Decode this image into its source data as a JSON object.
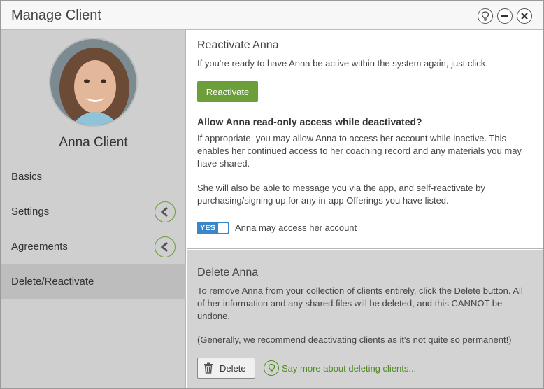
{
  "window": {
    "title": "Manage Client"
  },
  "sidebar": {
    "client_name": "Anna Client",
    "items": [
      {
        "label": "Basics",
        "has_arrow": false,
        "active": false
      },
      {
        "label": "Settings",
        "has_arrow": true,
        "active": false
      },
      {
        "label": "Agreements",
        "has_arrow": true,
        "active": false
      },
      {
        "label": "Delete/Reactivate",
        "has_arrow": false,
        "active": true
      }
    ]
  },
  "reactivate": {
    "title": "Reactivate Anna",
    "text": "If you're ready to have Anna be active within the system again, just click.",
    "button_label": "Reactivate",
    "question": "Allow Anna read-only access while deactivated?",
    "paragraph1": "If appropriate, you may allow Anna to access her account while inactive. This enables her continued access to her coaching record and any materials you may have shared.",
    "paragraph2": "She will also be able to message you via the app, and self-reactivate by purchasing/signing up for any in-app Offerings you have listed.",
    "toggle_state": "YES",
    "toggle_label": "Anna may access her account"
  },
  "delete": {
    "title": "Delete Anna",
    "paragraph1": "To remove Anna from your collection of clients entirely, click the Delete button. All of her information and any shared files will be deleted, and this CANNOT be undone.",
    "paragraph2": "(Generally, we recommend deactivating clients as it's not quite so permanent!)",
    "button_label": "Delete",
    "more_link": "Say more about deleting clients..."
  },
  "colors": {
    "accent_green": "#6c9e3a",
    "toggle_blue": "#3a86c8"
  }
}
